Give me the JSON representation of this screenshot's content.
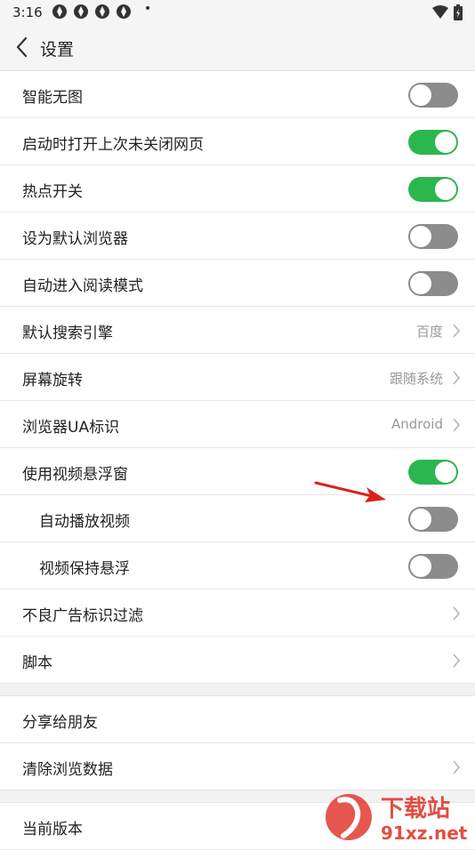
{
  "status_bar": {
    "time": "3:16",
    "dot": "•"
  },
  "header": {
    "title": "设置"
  },
  "settings": [
    {
      "label": "智能无图",
      "type": "toggle",
      "on": false
    },
    {
      "label": "启动时打开上次未关闭网页",
      "type": "toggle",
      "on": true
    },
    {
      "label": "热点开关",
      "type": "toggle",
      "on": true
    },
    {
      "label": "设为默认浏览器",
      "type": "toggle",
      "on": false
    },
    {
      "label": "自动进入阅读模式",
      "type": "toggle",
      "on": false
    },
    {
      "label": "默认搜索引擎",
      "type": "select",
      "value": "百度"
    },
    {
      "label": "屏幕旋转",
      "type": "select",
      "value": "跟随系统"
    },
    {
      "label": "浏览器UA标识",
      "type": "select",
      "value": "Android"
    },
    {
      "label": "使用视频悬浮窗",
      "type": "toggle",
      "on": true
    },
    {
      "label": "自动播放视频",
      "type": "toggle",
      "on": false,
      "sub": true
    },
    {
      "label": "视频保持悬浮",
      "type": "toggle",
      "on": false,
      "sub": true
    },
    {
      "label": "不良广告标识过滤",
      "type": "link"
    },
    {
      "label": "脚本",
      "type": "link"
    }
  ],
  "settings2": [
    {
      "label": "分享给朋友",
      "type": "plain"
    },
    {
      "label": "清除浏览数据",
      "type": "link"
    }
  ],
  "settings3": [
    {
      "label": "当前版本",
      "type": "plain"
    }
  ],
  "watermark": {
    "brand": "下载站",
    "domain": "91xz.net"
  },
  "colors": {
    "toggle_on": "#2bb74e",
    "toggle_off": "#8c8c8c",
    "annotation_arrow": "#d9221c"
  }
}
